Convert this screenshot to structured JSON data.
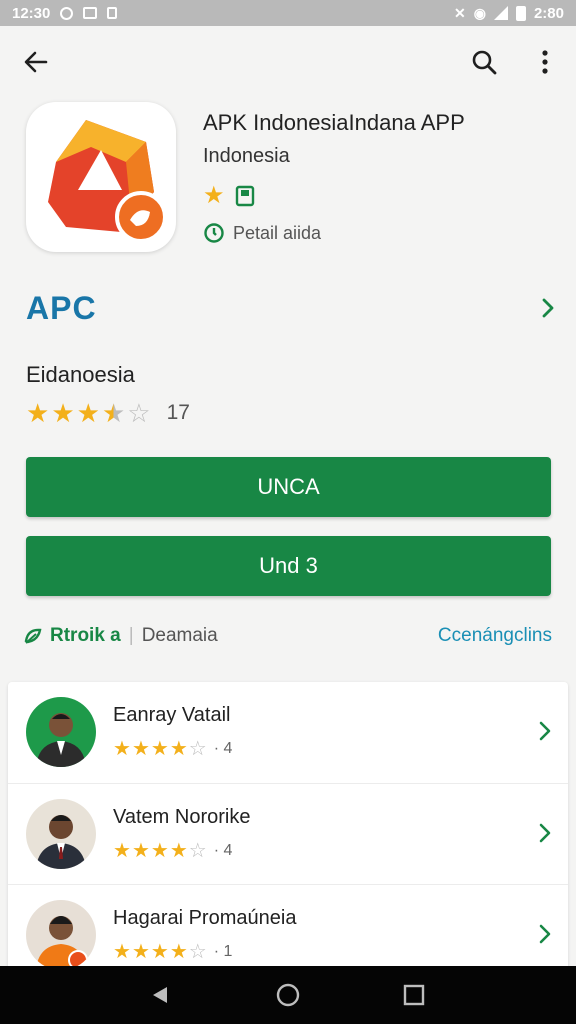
{
  "status_bar": {
    "time": "12:30",
    "right_text": "2:80"
  },
  "app": {
    "title": "APK IndonesiaIndana APP",
    "subtitle": "Indonesia",
    "meta_label": "Petail aiida"
  },
  "brand": {
    "text": "APC"
  },
  "developer": {
    "name": "Eidanoesia",
    "rating_count": "17",
    "rating": 3.5
  },
  "buttons": {
    "primary": "UNCA",
    "secondary": "Und 3"
  },
  "links": {
    "left": "Rtroik a",
    "middle": "Deamaia",
    "right": "Ccenángclins"
  },
  "list": [
    {
      "name": "Eanray Vatail",
      "rating_value": 4,
      "rating_label": "· 4",
      "avatar_bg": "#1e9a4a",
      "shirt": "#2c2c2c"
    },
    {
      "name": "Vatem Nororike",
      "rating_value": 4,
      "rating_label": "· 4",
      "avatar_bg": "#e8e2d8",
      "shirt": "#2a2f3a"
    },
    {
      "name": "Hagarai Promaúneia",
      "rating_value": 4,
      "rating_label": "· 1",
      "avatar_bg": "#e7dfd6",
      "shirt": "#f07a16"
    }
  ],
  "colors": {
    "accent_green": "#188745",
    "brand_blue": "#1976a8",
    "link_blue": "#1a8fb5",
    "star": "#f3b01b"
  },
  "icons": [
    "back-arrow-icon",
    "search-icon",
    "more-vert-icon",
    "star-icon",
    "bookmark-icon",
    "clock-icon",
    "chevron-right-icon",
    "leaf-icon",
    "nav-back-icon",
    "nav-home-icon",
    "nav-recents-icon"
  ]
}
